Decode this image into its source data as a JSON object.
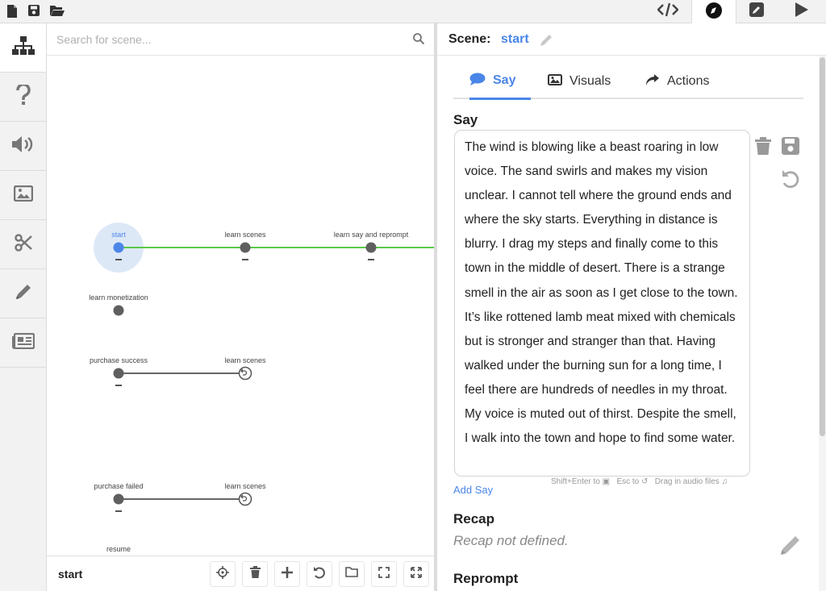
{
  "colors": {
    "accent": "#4a86e8",
    "edge_green": "#5ac84a",
    "edge_gray": "#666666",
    "node": "#5f5f5f"
  },
  "toolbar": {
    "left_icons": [
      "new-file-icon",
      "save-icon",
      "open-folder-icon"
    ],
    "right_icons": [
      "code-icon",
      "compass-icon",
      "edit-icon",
      "play-icon"
    ],
    "active_right": "compass-icon"
  },
  "rail": {
    "items": [
      "sitemap-icon",
      "help-icon",
      "volume-icon",
      "image-icon",
      "scissors-icon",
      "pencil-icon",
      "newspaper-icon"
    ]
  },
  "graph": {
    "search_placeholder": "Search for scene...",
    "nodes": [
      {
        "label": "start",
        "selected": true
      },
      {
        "label": "learn scenes"
      },
      {
        "label": "learn say and reprompt"
      },
      {
        "label": "learn monetization"
      },
      {
        "label": "purchase success"
      },
      {
        "label": "learn scenes",
        "type": "return"
      },
      {
        "label": "purchase failed"
      },
      {
        "label": "learn scenes",
        "type": "return"
      },
      {
        "label": "resume"
      }
    ],
    "footer": {
      "title": "start",
      "buttons": [
        "crosshair-icon",
        "trash-icon",
        "plus-icon",
        "undo-icon",
        "folder-icon",
        "fit-screen-icon",
        "expand-icon"
      ]
    }
  },
  "scene": {
    "label": "Scene:",
    "name": "start",
    "tabs": [
      {
        "label": "Say",
        "icon": "speech-bubble-icon",
        "active": true
      },
      {
        "label": "Visuals",
        "icon": "image-icon"
      },
      {
        "label": "Actions",
        "icon": "share-arrow-icon"
      }
    ],
    "say_title": "Say",
    "say_text": "The wind is blowing like a beast roaring in low voice. The sand swirls and makes my vision unclear. I cannot tell where the ground ends and where the sky starts. Everything in distance is blurry. I drag my steps and finally come to this town in the middle of desert. There is a strange smell in the air as soon as I get close to the town. It’s like rottened lamb meat mixed with chemicals but is stronger and stranger than that. Having walked under the burning sun for a long time, I feel there are hundreds of needles in my throat. My voice is muted out of thirst. Despite the smell, I walk into the town and hope to find some water.",
    "add_say": "Add Say",
    "hint_1": "Shift+Enter to",
    "hint_2": "Esc to",
    "hint_3": "Drag in audio files",
    "recap_title": "Recap",
    "recap_empty": "Recap not defined.",
    "reprompt_title": "Reprompt"
  }
}
